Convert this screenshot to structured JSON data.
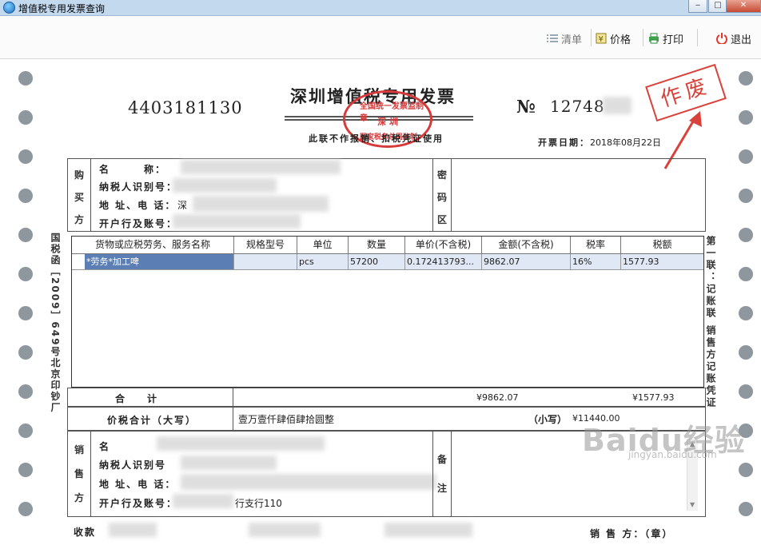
{
  "window": {
    "title": "增值税专用发票查询"
  },
  "toolbar": {
    "clear": "清单",
    "price": "价格",
    "print": "打印",
    "exit": "退出"
  },
  "invoice": {
    "title": "深圳增值税专用发票",
    "subtitle": "此联不作报销、扣税凭证使用",
    "code": "4403181130",
    "no_label": "№",
    "no_value": "12748",
    "date_label": "开票日期：",
    "date_value": "2018年08月22日",
    "seal_top": "全国统一发票监制章",
    "seal_mid": "深  圳",
    "seal_bot": "国家税务总局监制",
    "void_stamp": "作废",
    "left_margin": "国税函［2009］649号北京印钞厂",
    "right_margin": "第一联：记账联 销售方记账凭证",
    "buyer": {
      "section": [
        "购",
        "买",
        "方"
      ],
      "name_label": "名　　　称：",
      "taxid_label": "纳税人识别号：",
      "addr_label": "地 址、电 话：",
      "bank_label": "开户行及账号：",
      "addr_partial": "深"
    },
    "cipher_section": [
      "密",
      "码",
      "区"
    ],
    "goods": {
      "headers": [
        "货物或应税劳务、服务名称",
        "规格型号",
        "单位",
        "数量",
        "单价(不含税)",
        "金额(不含税)",
        "税率",
        "税额"
      ],
      "rows": [
        [
          "*劳务*加工啤",
          "",
          "pcs",
          "57200",
          "0.172413793...",
          "9862.07",
          "16%",
          "1577.93"
        ]
      ]
    },
    "totals": {
      "label": "合　计",
      "amount": "¥9862.07",
      "tax": "¥1577.93"
    },
    "grand": {
      "label": "价税合计（大写）",
      "words": "壹万壹仟肆佰肆拾圆整",
      "small_label": "（小写）",
      "small_value": "¥11440.00"
    },
    "seller": {
      "section": [
        "销",
        "售",
        "方"
      ],
      "name_label": "名",
      "taxid_label": "纳税人识别号",
      "addr_label": "地 址、电 话：",
      "bank_label": "开户行及账号：",
      "bank_partial": "行支行110"
    },
    "remark_section": [
      "备",
      "注"
    ],
    "payee_label": "收款",
    "seller_stamp_label": "销 售 方：（章）"
  },
  "watermark": {
    "brand": "Baidu经验",
    "url": "jingyan.baidu.com"
  },
  "colors": {
    "stamp_red": "#d63a3a",
    "selection": "#5b7fb5",
    "row_bg": "#dfe8f4",
    "titlebar": "#c3d9ee"
  }
}
